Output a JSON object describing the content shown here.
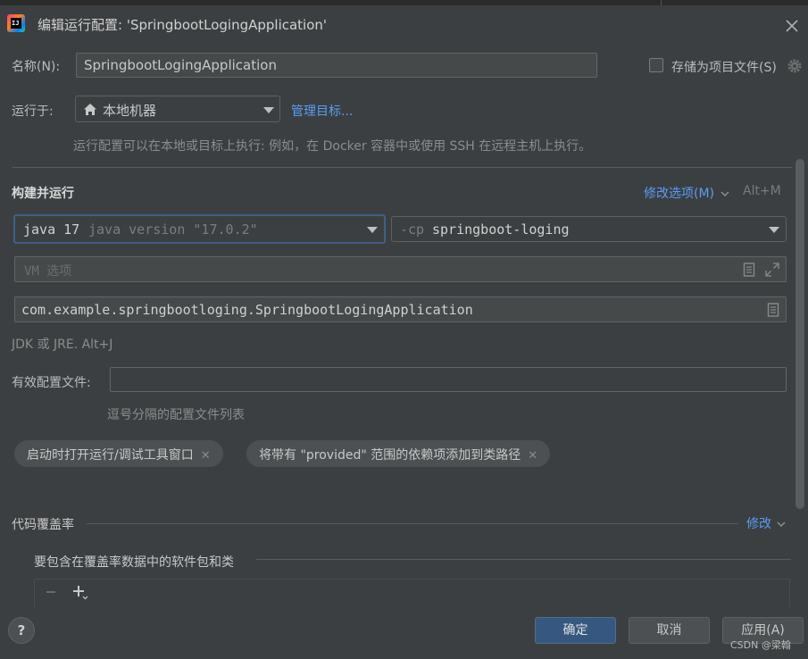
{
  "window": {
    "title": "编辑运行配置: 'SpringbootLogingApplication'"
  },
  "name_row": {
    "label": "名称(N):",
    "value": "SpringbootLogingApplication",
    "store_label": "存储为项目文件(S)",
    "store_checked": false
  },
  "run_on": {
    "label": "运行于:",
    "selected": "本地机器",
    "manage_link": "管理目标...",
    "hint": "运行配置可以在本地或目标上执行: 例如，在 Docker 容器中或使用 SSH 在远程主机上执行。"
  },
  "build_run": {
    "section_title": "构建并运行",
    "modify_options": "修改选项(M)",
    "modify_shortcut": "Alt+M",
    "jdk_main": "java 17",
    "jdk_detail": "java version \"17.0.2\"",
    "cp_prefix": "-cp",
    "cp_value": "springboot-loging",
    "vm_placeholder": "VM 选项",
    "main_class": "com.example.springbootloging.SpringbootLogingApplication",
    "jdk_hint": "JDK 或 JRE. Alt+J"
  },
  "profiles": {
    "label": "有效配置文件:",
    "value": "",
    "hint": "逗号分隔的配置文件列表"
  },
  "chips": [
    {
      "label": "启动时打开运行/调试工具窗口"
    },
    {
      "label": "将带有 \"provided\" 范围的依赖项添加到类路径"
    }
  ],
  "coverage": {
    "section_title": "代码覆盖率",
    "modify_link": "修改",
    "include_title": "要包含在覆盖率数据中的软件包和类"
  },
  "buttons": {
    "ok": "确定",
    "cancel": "取消",
    "apply": "应用(A)",
    "help": "?"
  },
  "watermark": "CSDN @梁翰",
  "colors": {
    "background": "#3c3f41",
    "field": "#45494a",
    "accent_link": "#589df6",
    "focus_border": "#3d6185",
    "primary_button": "#365880"
  }
}
